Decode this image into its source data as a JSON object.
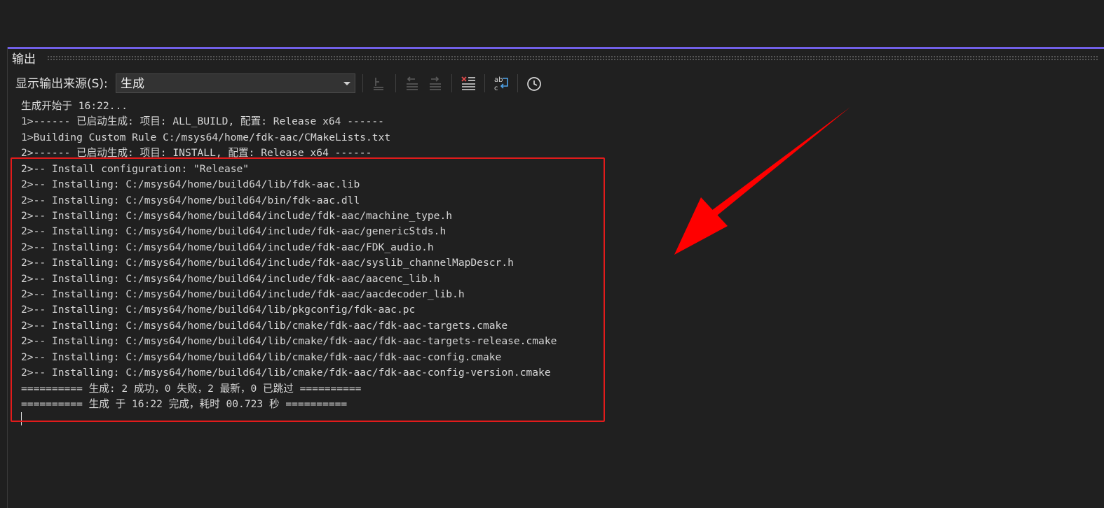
{
  "panel": {
    "title": "输出",
    "accent_color": "#7160e8"
  },
  "toolbar": {
    "source_label": "显示输出来源(S):",
    "source_selected": "生成",
    "buttons": [
      {
        "name": "find-message-in-code-icon",
        "enabled": false
      },
      {
        "name": "go-to-previous-message-icon",
        "enabled": false
      },
      {
        "name": "go-to-next-message-icon",
        "enabled": false
      },
      {
        "name": "clear-all-icon",
        "enabled": true
      },
      {
        "name": "toggle-word-wrap-icon",
        "enabled": true
      },
      {
        "name": "show-timestamps-icon",
        "enabled": true
      }
    ]
  },
  "output": {
    "lines": [
      "生成开始于 16:22...",
      "1>------ 已启动生成: 项目: ALL_BUILD, 配置: Release x64 ------",
      "1>Building Custom Rule C:/msys64/home/fdk-aac/CMakeLists.txt",
      "2>------ 已启动生成: 项目: INSTALL, 配置: Release x64 ------",
      "2>-- Install configuration: \"Release\"",
      "2>-- Installing: C:/msys64/home/build64/lib/fdk-aac.lib",
      "2>-- Installing: C:/msys64/home/build64/bin/fdk-aac.dll",
      "2>-- Installing: C:/msys64/home/build64/include/fdk-aac/machine_type.h",
      "2>-- Installing: C:/msys64/home/build64/include/fdk-aac/genericStds.h",
      "2>-- Installing: C:/msys64/home/build64/include/fdk-aac/FDK_audio.h",
      "2>-- Installing: C:/msys64/home/build64/include/fdk-aac/syslib_channelMapDescr.h",
      "2>-- Installing: C:/msys64/home/build64/include/fdk-aac/aacenc_lib.h",
      "2>-- Installing: C:/msys64/home/build64/include/fdk-aac/aacdecoder_lib.h",
      "2>-- Installing: C:/msys64/home/build64/lib/pkgconfig/fdk-aac.pc",
      "2>-- Installing: C:/msys64/home/build64/lib/cmake/fdk-aac/fdk-aac-targets.cmake",
      "2>-- Installing: C:/msys64/home/build64/lib/cmake/fdk-aac/fdk-aac-targets-release.cmake",
      "2>-- Installing: C:/msys64/home/build64/lib/cmake/fdk-aac/fdk-aac-config.cmake",
      "2>-- Installing: C:/msys64/home/build64/lib/cmake/fdk-aac/fdk-aac-config-version.cmake",
      "========== 生成: 2 成功，0 失败，2 最新，0 已跳过 ==========",
      "========== 生成 于 16:22 完成，耗时 00.723 秒 =========="
    ]
  },
  "annotation": {
    "highlight_color": "#e21b1b",
    "arrow_color": "#ff0000"
  }
}
